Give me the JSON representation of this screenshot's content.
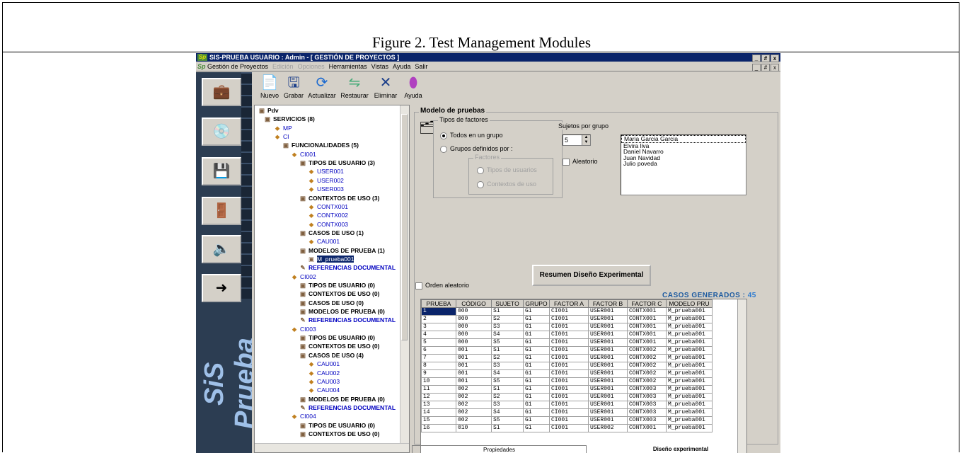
{
  "caption": "Figure 2. Test Management Modules",
  "window": {
    "title": "SIS-PRUEBA   USUARIO : Admin - [  GESTIÓN DE PROYECTOS  ]",
    "controls": [
      "_",
      "#",
      "x"
    ]
  },
  "menu": {
    "items": [
      "Gestión de Proyectos",
      "Edición",
      "Opciones",
      "Herramientas",
      "Vistas",
      "Ayuda",
      "Salir"
    ],
    "disabled": [
      "Edición",
      "Opciones"
    ]
  },
  "sidebar": {
    "brand": "SiS Prueba",
    "tiles": [
      "briefcase-icon",
      "cd-icon",
      "disk-icon",
      "exit-door-icon",
      "speaker-icon",
      "logout-icon"
    ]
  },
  "toolbar": {
    "buttons": [
      {
        "label": "Nuevo",
        "icon": "new-doc-icon"
      },
      {
        "label": "Grabar",
        "icon": "save-icon"
      },
      {
        "label": "Actualizar",
        "icon": "refresh-icon"
      },
      {
        "label": "Restaurar",
        "icon": "restore-icon"
      },
      {
        "label": "Eliminar",
        "icon": "delete-icon"
      },
      {
        "label": "Ayuda",
        "icon": "help-icon"
      }
    ]
  },
  "tree": {
    "nodes": [
      {
        "label": "Pdv",
        "style": "bold"
      },
      {
        "label": "SERVICIOS (8)",
        "style": "bold"
      },
      {
        "label": "MP",
        "style": "blue"
      },
      {
        "label": "CI",
        "style": "blue"
      },
      {
        "label": "FUNCIONALIDADES (5)",
        "style": "bold"
      },
      {
        "label": "CI001",
        "style": "blue"
      },
      {
        "label": "TIPOS DE USUARIO (3)",
        "style": "bold"
      },
      {
        "label": "USER001",
        "style": "blue"
      },
      {
        "label": "USER002",
        "style": "blue"
      },
      {
        "label": "USER003",
        "style": "blue"
      },
      {
        "label": "CONTEXTOS DE USO (3)",
        "style": "bold"
      },
      {
        "label": "CONTX001",
        "style": "blue"
      },
      {
        "label": "CONTX002",
        "style": "blue"
      },
      {
        "label": "CONTX003",
        "style": "blue"
      },
      {
        "label": "CASOS DE USO (1)",
        "style": "bold"
      },
      {
        "label": "CAU001",
        "style": "blue"
      },
      {
        "label": "MODELOS DE PRUEBA (1)",
        "style": "bold"
      },
      {
        "label": "M_prueba001",
        "style": "sel"
      },
      {
        "label": "REFERENCIAS DOCUMENTAL",
        "style": "bold-blue"
      },
      {
        "label": "CI002",
        "style": "blue"
      },
      {
        "label": "TIPOS DE USUARIO (0)",
        "style": "bold"
      },
      {
        "label": "CONTEXTOS DE USO (0)",
        "style": "bold"
      },
      {
        "label": "CASOS DE USO (0)",
        "style": "bold"
      },
      {
        "label": "MODELOS DE PRUEBA (0)",
        "style": "bold"
      },
      {
        "label": "REFERENCIAS DOCUMENTAL",
        "style": "bold-blue"
      },
      {
        "label": "CI003",
        "style": "blue"
      },
      {
        "label": "TIPOS DE USUARIO (0)",
        "style": "bold"
      },
      {
        "label": "CONTEXTOS DE USO (0)",
        "style": "bold"
      },
      {
        "label": "CASOS DE USO (4)",
        "style": "bold"
      },
      {
        "label": "CAU001",
        "style": "blue"
      },
      {
        "label": "CAU002",
        "style": "blue"
      },
      {
        "label": "CAU003",
        "style": "blue"
      },
      {
        "label": "CAU004",
        "style": "blue"
      },
      {
        "label": "MODELOS DE PRUEBA (0)",
        "style": "bold"
      },
      {
        "label": "REFERENCIAS DOCUMENTAL",
        "style": "bold-blue"
      },
      {
        "label": "CI004",
        "style": "blue"
      },
      {
        "label": "TIPOS DE USUARIO (0)",
        "style": "bold"
      },
      {
        "label": "CONTEXTOS DE USO (0)",
        "style": "bold"
      }
    ]
  },
  "model": {
    "title": "Modelo de pruebas",
    "factor_types": {
      "label": "Tipos de factores",
      "options": [
        "Todos en un grupo",
        "Grupos definidos por :"
      ],
      "selected": 0,
      "factors_label": "Factores",
      "factor_options": [
        "Tipos de usuarios",
        "Contextos de uso"
      ]
    },
    "subjects": {
      "label": "Sujetos por grupo",
      "count": "5",
      "random_label": "Aleatorio",
      "names": [
        "Maria Garcia Garcia",
        "Elvira liva",
        "Daniel Navarro",
        "Juan Navidad",
        "Julio poveda"
      ]
    },
    "random_order_label": "Orden aleatorio",
    "summary_button": "Resumen Diseño Experimental",
    "cases_label": "CASOS GENERADOS :",
    "cases_count": "45"
  },
  "grid": {
    "columns": [
      "PRUEBA",
      "CÓDIGO",
      "SUJETO",
      "GRUPO",
      "FACTOR A",
      "FACTOR B",
      "FACTOR C",
      "MODELO PRU"
    ],
    "rows": [
      [
        "1",
        "000",
        "S1",
        "G1",
        "CI001",
        "USER001",
        "CONTX001",
        "M_prueba001"
      ],
      [
        "2",
        "000",
        "S2",
        "G1",
        "CI001",
        "USER001",
        "CONTX001",
        "M_prueba001"
      ],
      [
        "3",
        "000",
        "S3",
        "G1",
        "CI001",
        "USER001",
        "CONTX001",
        "M_prueba001"
      ],
      [
        "4",
        "000",
        "S4",
        "G1",
        "CI001",
        "USER001",
        "CONTX001",
        "M_prueba001"
      ],
      [
        "5",
        "000",
        "S5",
        "G1",
        "CI001",
        "USER001",
        "CONTX001",
        "M_prueba001"
      ],
      [
        "6",
        "001",
        "S1",
        "G1",
        "CI001",
        "USER001",
        "CONTX002",
        "M_prueba001"
      ],
      [
        "7",
        "001",
        "S2",
        "G1",
        "CI001",
        "USER001",
        "CONTX002",
        "M_prueba001"
      ],
      [
        "8",
        "001",
        "S3",
        "G1",
        "CI001",
        "USER001",
        "CONTX002",
        "M_prueba001"
      ],
      [
        "9",
        "001",
        "S4",
        "G1",
        "CI001",
        "USER001",
        "CONTX002",
        "M_prueba001"
      ],
      [
        "10",
        "001",
        "S5",
        "G1",
        "CI001",
        "USER001",
        "CONTX002",
        "M_prueba001"
      ],
      [
        "11",
        "002",
        "S1",
        "G1",
        "CI001",
        "USER001",
        "CONTX003",
        "M_prueba001"
      ],
      [
        "12",
        "002",
        "S2",
        "G1",
        "CI001",
        "USER001",
        "CONTX003",
        "M_prueba001"
      ],
      [
        "13",
        "002",
        "S3",
        "G1",
        "CI001",
        "USER001",
        "CONTX003",
        "M_prueba001"
      ],
      [
        "14",
        "002",
        "S4",
        "G1",
        "CI001",
        "USER001",
        "CONTX003",
        "M_prueba001"
      ],
      [
        "15",
        "002",
        "S5",
        "G1",
        "CI001",
        "USER001",
        "CONTX003",
        "M_prueba001"
      ],
      [
        "16",
        "010",
        "S1",
        "G1",
        "CI001",
        "USER002",
        "CONTX001",
        "M_prueba001"
      ]
    ]
  },
  "tabs": [
    "Propiedades",
    "Diseño experimental"
  ]
}
